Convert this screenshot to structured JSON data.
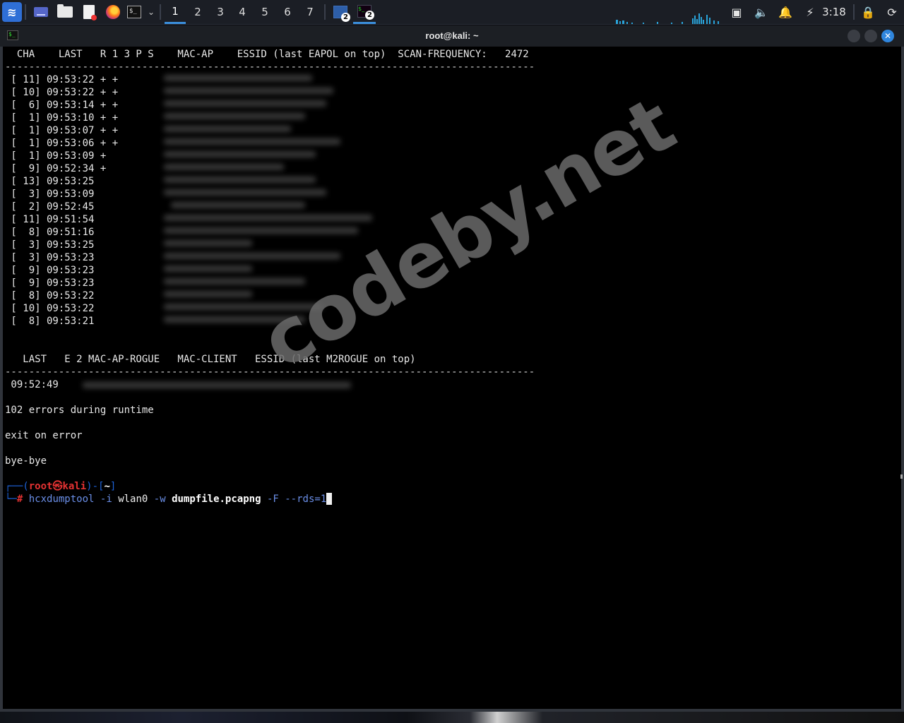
{
  "taskbar": {
    "workspaces": [
      {
        "label": "1",
        "active": true
      },
      {
        "label": "2",
        "active": false
      },
      {
        "label": "3",
        "active": false
      },
      {
        "label": "4",
        "active": false
      },
      {
        "label": "5",
        "active": false
      },
      {
        "label": "6",
        "active": false
      },
      {
        "label": "7",
        "active": false
      }
    ],
    "task_badges": [
      "2",
      "2"
    ],
    "clock": "3:18",
    "icons": [
      "kali-menu-icon",
      "desktop-icon",
      "file-manager-icon",
      "text-editor-icon",
      "firefox-icon",
      "terminal-icon",
      "chevron-down-icon",
      "network-icon",
      "volume-icon",
      "bell-icon",
      "power-icon",
      "lock-icon",
      "logout-icon"
    ]
  },
  "window": {
    "title": "root@kali: ~",
    "close_glyph": "✕"
  },
  "terminal": {
    "header1": "  CHA    LAST   R 1 3 P S    MAC-AP    ESSID (last EAPOL on top)  SCAN-FREQUENCY:   2472",
    "dashes": "-----------------------------------------------------------------------------------------",
    "rows": [
      " [ 11] 09:53:22 + +",
      " [ 10] 09:53:22 + +",
      " [  6] 09:53:14 + +",
      " [  1] 09:53:10 + +",
      " [  1] 09:53:07 + +",
      " [  1] 09:53:06 + +",
      " [  1] 09:53:09 +",
      " [  9] 09:52:34 +",
      " [ 13] 09:53:25",
      " [  3] 09:53:09",
      " [  2] 09:52:45",
      " [ 11] 09:51:54",
      " [  8] 09:51:16",
      " [  3] 09:53:25",
      " [  3] 09:53:23",
      " [  9] 09:53:23",
      " [  9] 09:53:23",
      " [  8] 09:53:22",
      " [ 10] 09:53:22",
      " [  8] 09:53:21"
    ],
    "header2": "   LAST   E 2 MAC-AP-ROGUE   MAC-CLIENT   ESSID (last M2ROGUE on top)",
    "rogue_row": " 09:52:49",
    "messages": [
      "102 errors during runtime",
      "exit on error",
      "bye-bye"
    ],
    "prompt": {
      "prefix": "┌──(",
      "user_host_root": "root",
      "at_symbol": "㉿",
      "host": "kali",
      "mid": ")-[",
      "dir": "~",
      "suffix": "]",
      "second_prefix": "└─",
      "hash": "#"
    },
    "command": {
      "tool": "hcxdumptool",
      "flag_i": "-i",
      "iface": "wlan0",
      "flag_w": "-w",
      "file": "dumpfile.pcapng",
      "flag_F": "-F",
      "rds": "--rds=1"
    }
  },
  "watermark": "codeby.net"
}
